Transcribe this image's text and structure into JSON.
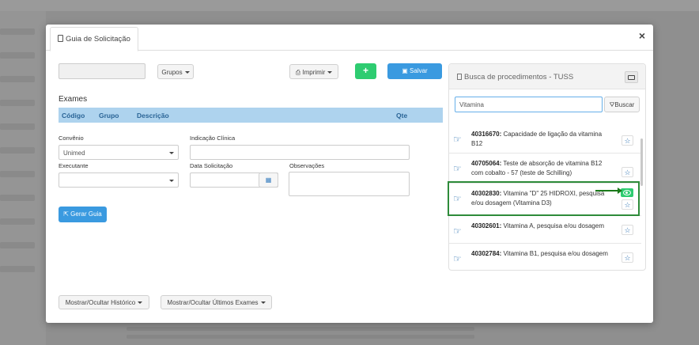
{
  "modal": {
    "tab_label": "Guia de Solicitação"
  },
  "toolbar": {
    "grupos_label": "Grupos",
    "imprimir_label": "Imprimir",
    "add_label": "+",
    "salvar_label": "Salvar"
  },
  "exames": {
    "title": "Exames",
    "columns": [
      "Código",
      "Grupo",
      "Descrição",
      "Qte"
    ]
  },
  "form": {
    "convenio_label": "Convênio",
    "convenio_value": "Unimed",
    "indicacao_label": "Indicação Clínica",
    "executante_label": "Executante",
    "data_label": "Data Solicitação",
    "observacoes_label": "Observações",
    "gerar_guia_label": "Gerar Guia"
  },
  "footer": {
    "historico_label": "Mostrar/Ocultar Histórico",
    "ultimos_label": "Mostrar/Ocultar Últimos Exames"
  },
  "search_panel": {
    "title": "Busca de procedimentos - TUSS",
    "search_value": "Vitamina",
    "search_button": "Buscar",
    "results": [
      {
        "code": "40316670:",
        "description": "Capacidade de ligação da vitamina B12"
      },
      {
        "code": "40705064:",
        "description": "Teste de absorção de vitamina B12 com cobalto - 57 (teste de Schilling)"
      },
      {
        "code": "40302830:",
        "description": "Vitamina \"D\" 25 HIDROXI, pesquisa e/ou dosagem (Vitamina D3)"
      },
      {
        "code": "40302601:",
        "description": "Vitamina A, pesquisa e/ou dosagem"
      },
      {
        "code": "40302784:",
        "description": "Vitamina B1, pesquisa e/ou dosagem"
      }
    ]
  },
  "colors": {
    "primary": "#3a9ae0",
    "success": "#2ecc71",
    "table_header": "#aed3ee",
    "highlight": "#2e8b3a"
  }
}
